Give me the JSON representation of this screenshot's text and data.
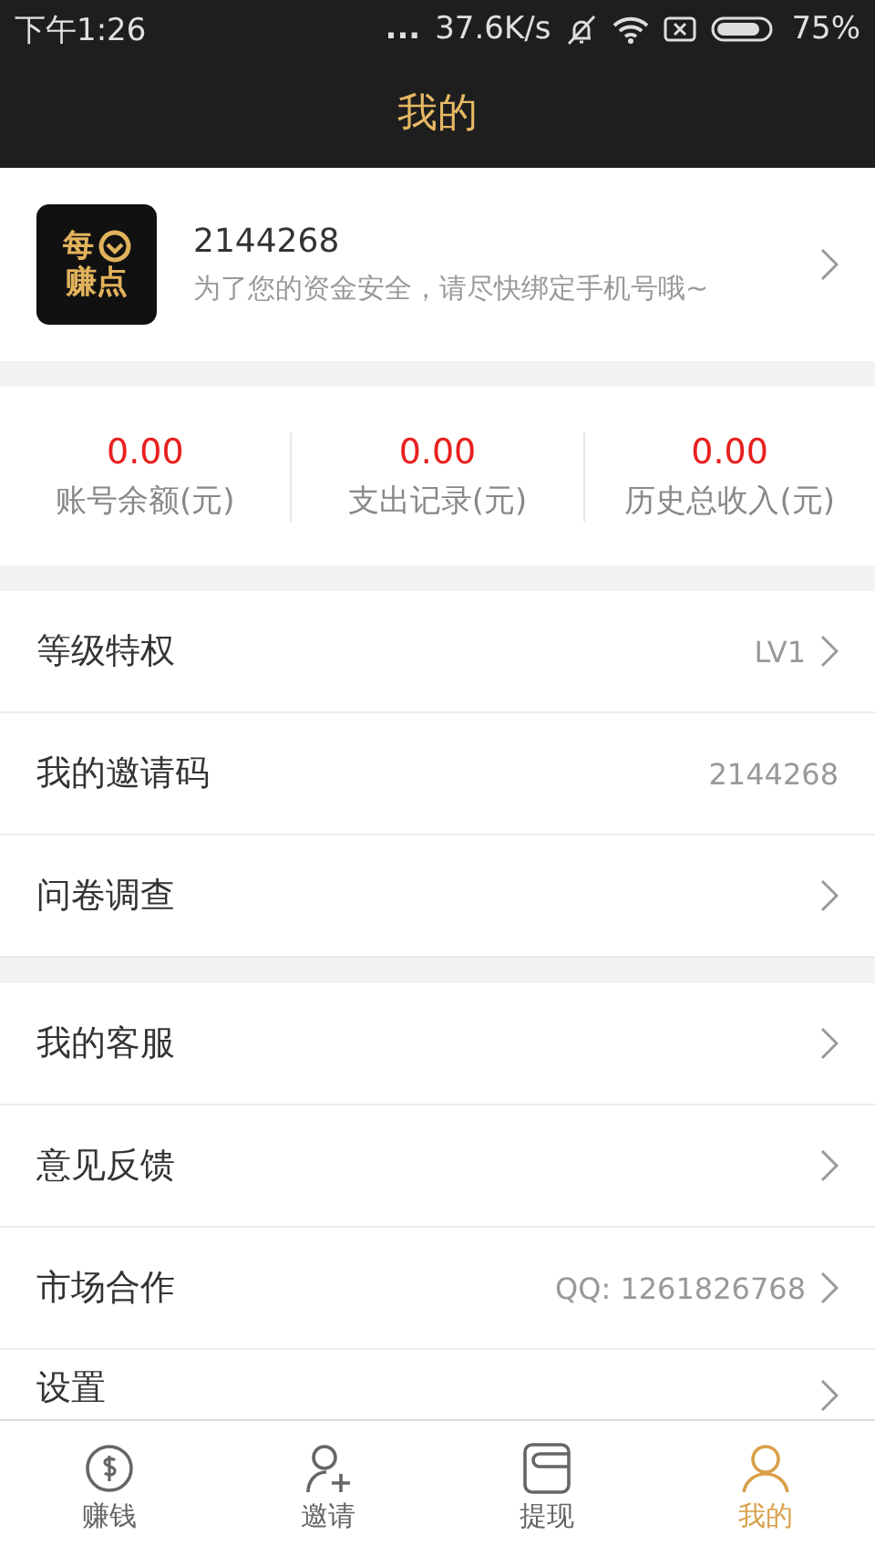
{
  "status_bar": {
    "time": "下午1:26",
    "dots": "...",
    "speed": "37.6K/s",
    "battery": "75%"
  },
  "title": "我的",
  "profile": {
    "logo_top": "每",
    "logo_bottom": "赚点",
    "user_id": "2144268",
    "notice": "为了您的资金安全，请尽快绑定手机号哦~"
  },
  "stats": [
    {
      "value": "0.00",
      "label": "账号余额(元)"
    },
    {
      "value": "0.00",
      "label": "支出记录(元)"
    },
    {
      "value": "0.00",
      "label": "历史总收入(元)"
    }
  ],
  "menu_groups": [
    [
      {
        "label": "等级特权",
        "value": "LV1",
        "chevron": true
      },
      {
        "label": "我的邀请码",
        "value": "2144268",
        "chevron": false
      },
      {
        "label": "问卷调查",
        "chevron": true
      }
    ],
    [
      {
        "label": "我的客服",
        "chevron": true
      },
      {
        "label": "意见反馈",
        "chevron": true
      },
      {
        "label": "市场合作",
        "value": "QQ: 1261826768",
        "chevron": true
      },
      {
        "label": "设置",
        "chevron": true
      }
    ]
  ],
  "tabs": [
    {
      "label": "赚钱",
      "kind": "coin",
      "selected": false
    },
    {
      "label": "邀请",
      "kind": "invite",
      "selected": false
    },
    {
      "label": "提现",
      "kind": "wallet",
      "selected": false
    },
    {
      "label": "我的",
      "kind": "person",
      "selected": true
    }
  ]
}
